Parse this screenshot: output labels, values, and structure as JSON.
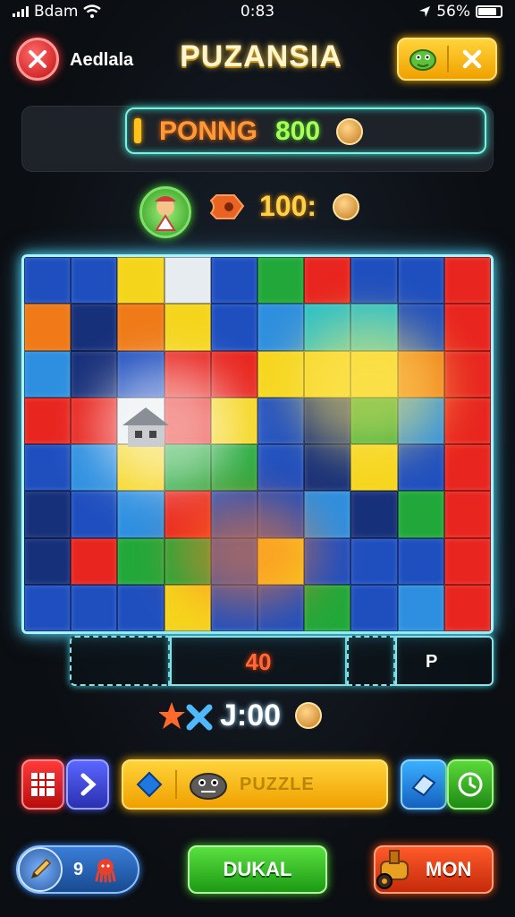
{
  "status_bar": {
    "carrier": "Bdam",
    "time": "0:83",
    "battery": "56%",
    "battery_level": 0.56
  },
  "header": {
    "player_name": "Aedlala",
    "title": "PUZANSIA"
  },
  "score_bar": {
    "label": "PONNG",
    "value": "800"
  },
  "coins": {
    "value": "100:"
  },
  "board": {
    "columns": 10,
    "rows": 8,
    "colors": {
      "B": "#1f4fbf",
      "D": "#17307a",
      "L": "#2e8fe0",
      "R": "#e8251f",
      "Y": "#f5d51c",
      "O": "#ef7a17",
      "G": "#22a83a",
      "T": "#2dc0c8",
      "W": "#e6ecef"
    },
    "tiles": [
      "BBYWBGRBBR",
      "ODOYBLTTBR",
      "LDBRRYYYOR",
      "RRWRYBDGLR",
      "BLYGGBDYBR",
      "DBLRBBLDGR",
      "DRGGBYBBBR",
      "BBBYBBGBLR"
    ]
  },
  "tray": {
    "counter": "40",
    "slot_label": "P"
  },
  "timer": {
    "value": "J:00"
  },
  "actions": {
    "puzzle_label": "PUZZLE",
    "left_count": "9",
    "center_label": "DUKAL",
    "right_label": "MON"
  }
}
